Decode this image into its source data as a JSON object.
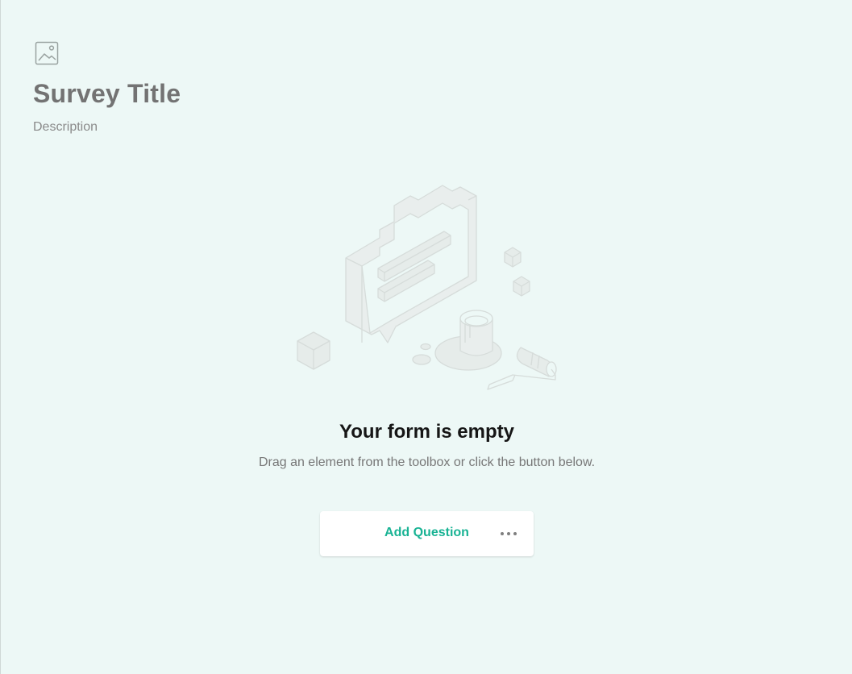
{
  "survey": {
    "title": "Survey Title",
    "description": "Description",
    "logo_icon": "image-placeholder-icon"
  },
  "empty_state": {
    "title": "Your form is empty",
    "subtitle": "Drag an element from the toolbox or click the button below.",
    "illustration_icon": "empty-form-illustration"
  },
  "add_question": {
    "label": "Add Question",
    "more_icon": "more-options-icon"
  },
  "colors": {
    "background": "#edf8f6",
    "accent": "#19b394",
    "title": "#737373"
  }
}
